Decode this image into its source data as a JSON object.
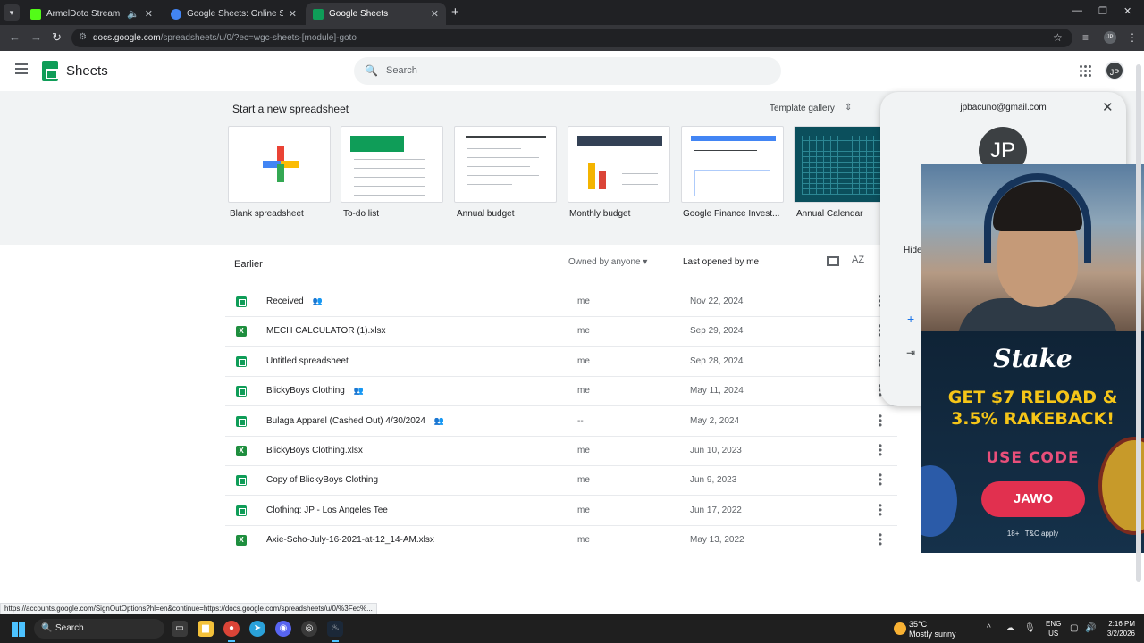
{
  "browser": {
    "tabs": [
      {
        "title": "ArmelDoto Stream - Watch",
        "favicon_color": "#53fc18"
      },
      {
        "title": "Google Sheets: Online Spreadsh",
        "favicon_color": "#4285f4"
      },
      {
        "title": "Google Sheets",
        "favicon_color": "#0f9d58"
      }
    ],
    "url_main": "docs.google.com",
    "url_rest": "/spreadsheets/u/0/?ec=wgc-sheets-[module]-goto",
    "profile_initials": "JP"
  },
  "app": {
    "name": "Sheets",
    "search_placeholder": "Search",
    "avatar_initials": "JP"
  },
  "templates": {
    "heading": "Start a new spreadsheet",
    "gallery_label": "Template gallery",
    "items": [
      {
        "label": "Blank spreadsheet"
      },
      {
        "label": "To-do list"
      },
      {
        "label": "Annual budget"
      },
      {
        "label": "Monthly budget"
      },
      {
        "label": "Google Finance Invest..."
      },
      {
        "label": "Annual Calendar"
      }
    ]
  },
  "files": {
    "section_title": "Earlier",
    "owner_filter": "Owned by anyone",
    "sort_label": "Last opened by me",
    "rows": [
      {
        "name": "Received",
        "type": "sheet",
        "shared": true,
        "owner": "me",
        "date": "Nov 22, 2024"
      },
      {
        "name": "MECH CALCULATOR (1).xlsx",
        "type": "xlsx",
        "shared": false,
        "owner": "me",
        "date": "Sep 29, 2024"
      },
      {
        "name": "Untitled spreadsheet",
        "type": "sheet",
        "shared": false,
        "owner": "me",
        "date": "Sep 28, 2024"
      },
      {
        "name": "BlickyBoys Clothing",
        "type": "sheet",
        "shared": true,
        "owner": "me",
        "date": "May 11, 2024"
      },
      {
        "name": "Bulaga Apparel (Cashed Out) 4/30/2024",
        "type": "sheet",
        "shared": true,
        "owner": "--",
        "date": "May 2, 2024"
      },
      {
        "name": "BlickyBoys Clothing.xlsx",
        "type": "xlsx",
        "shared": false,
        "owner": "me",
        "date": "Jun 10, 2023"
      },
      {
        "name": "Copy of BlickyBoys Clothing",
        "type": "sheet",
        "shared": false,
        "owner": "me",
        "date": "Jun 9, 2023"
      },
      {
        "name": "Clothing: JP - Los Angeles Tee",
        "type": "sheet",
        "shared": false,
        "owner": "me",
        "date": "Jun 17, 2022"
      },
      {
        "name": "Axie-Scho-July-16-2021-at-12_14-AM.xlsx",
        "type": "xlsx",
        "shared": false,
        "owner": "me",
        "date": "May 13, 2022"
      }
    ]
  },
  "account_popover": {
    "email": "jpbacuno@gmail.com",
    "initials": "JP",
    "hide_label": "Hide"
  },
  "ad": {
    "brand": "Stake",
    "promo_line1": "GET $7 RELOAD &",
    "promo_line2": "3.5% RAKEBACK!",
    "use_code": "USE CODE",
    "code": "JAWO",
    "terms": "18+ | T&C apply"
  },
  "status_link": "https://accounts.google.com/SignOutOptions?hl=en&continue=https://docs.google.com/spreadsheets/u/0/%3Fec%...",
  "taskbar": {
    "search_label": "Search",
    "temperature": "35°C",
    "condition": "Mostly sunny",
    "lang_top": "ENG",
    "lang_bottom": "US",
    "time": "2:16 PM",
    "date": "3/2/2026"
  }
}
